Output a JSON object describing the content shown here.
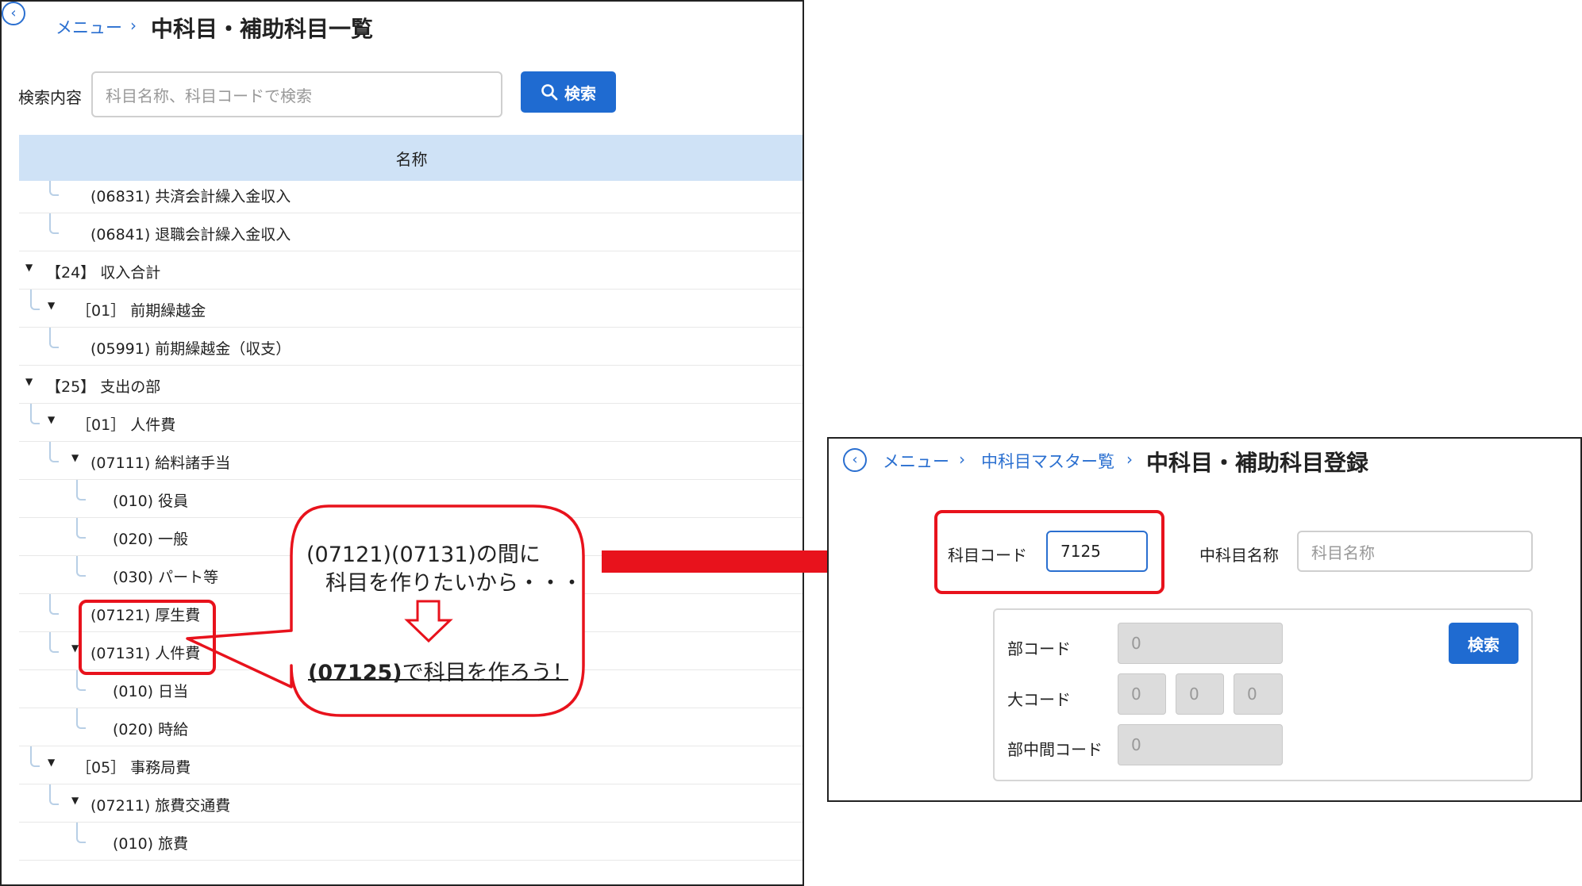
{
  "left_screen": {
    "breadcrumb": {
      "menu": "メニュー",
      "separator": "›"
    },
    "title": "中科目・補助科目一覧",
    "search": {
      "label": "検索内容",
      "placeholder": "科目名称、科目コードで検索",
      "button": "検索"
    },
    "tree": {
      "header": "名称",
      "rows": [
        {
          "text": "(06831) 共済会計繰入金収入",
          "caret": false
        },
        {
          "text": "(06841) 退職会計繰入金収入",
          "caret": false
        },
        {
          "text": "【24】 収入合計",
          "caret": true
        },
        {
          "text": "［01］ 前期繰越金",
          "caret": true
        },
        {
          "text": "(05991) 前期繰越金（収支）",
          "caret": false
        },
        {
          "text": "【25】 支出の部",
          "caret": true
        },
        {
          "text": "［01］ 人件費",
          "caret": true
        },
        {
          "text": "(07111) 給料諸手当",
          "caret": true
        },
        {
          "text": "(010) 役員",
          "caret": false
        },
        {
          "text": "(020) 一般",
          "caret": false
        },
        {
          "text": "(030) パート等",
          "caret": false
        },
        {
          "text": "(07121) 厚生費",
          "caret": false
        },
        {
          "text": "(07131) 人件費",
          "caret": true
        },
        {
          "text": "(010) 日当",
          "caret": false
        },
        {
          "text": "(020) 時給",
          "caret": false
        },
        {
          "text": "［05］ 事務局費",
          "caret": true
        },
        {
          "text": "(07211) 旅費交通費",
          "caret": true
        },
        {
          "text": "(010) 旅費",
          "caret": false
        }
      ]
    }
  },
  "callout": {
    "line1": "(07121)(07131)の間に",
    "line2": "科目を作りたいから・・・",
    "line3_bold": "(07125)",
    "line3_rest": "で科目を作ろう！"
  },
  "right_screen": {
    "breadcrumb": {
      "menu": "メニュー",
      "master": "中科目マスター覧",
      "separator": "›"
    },
    "title": "中科目・補助科目登録",
    "code": {
      "label": "科目コード",
      "value": "7125"
    },
    "name": {
      "label": "中科目名称",
      "placeholder": "科目名称"
    },
    "sub": {
      "bu_label": "部コード",
      "bu_value": "0",
      "dai_label": "大コード",
      "dai_values": [
        "0",
        "0",
        "0"
      ],
      "buchukan_label": "部中間コード",
      "buchukan_value": "0",
      "search_button": "検索"
    }
  },
  "colors": {
    "accent": "#1f6bd1",
    "highlight": "#e8121c",
    "tree_header": "#cfe2f6"
  }
}
